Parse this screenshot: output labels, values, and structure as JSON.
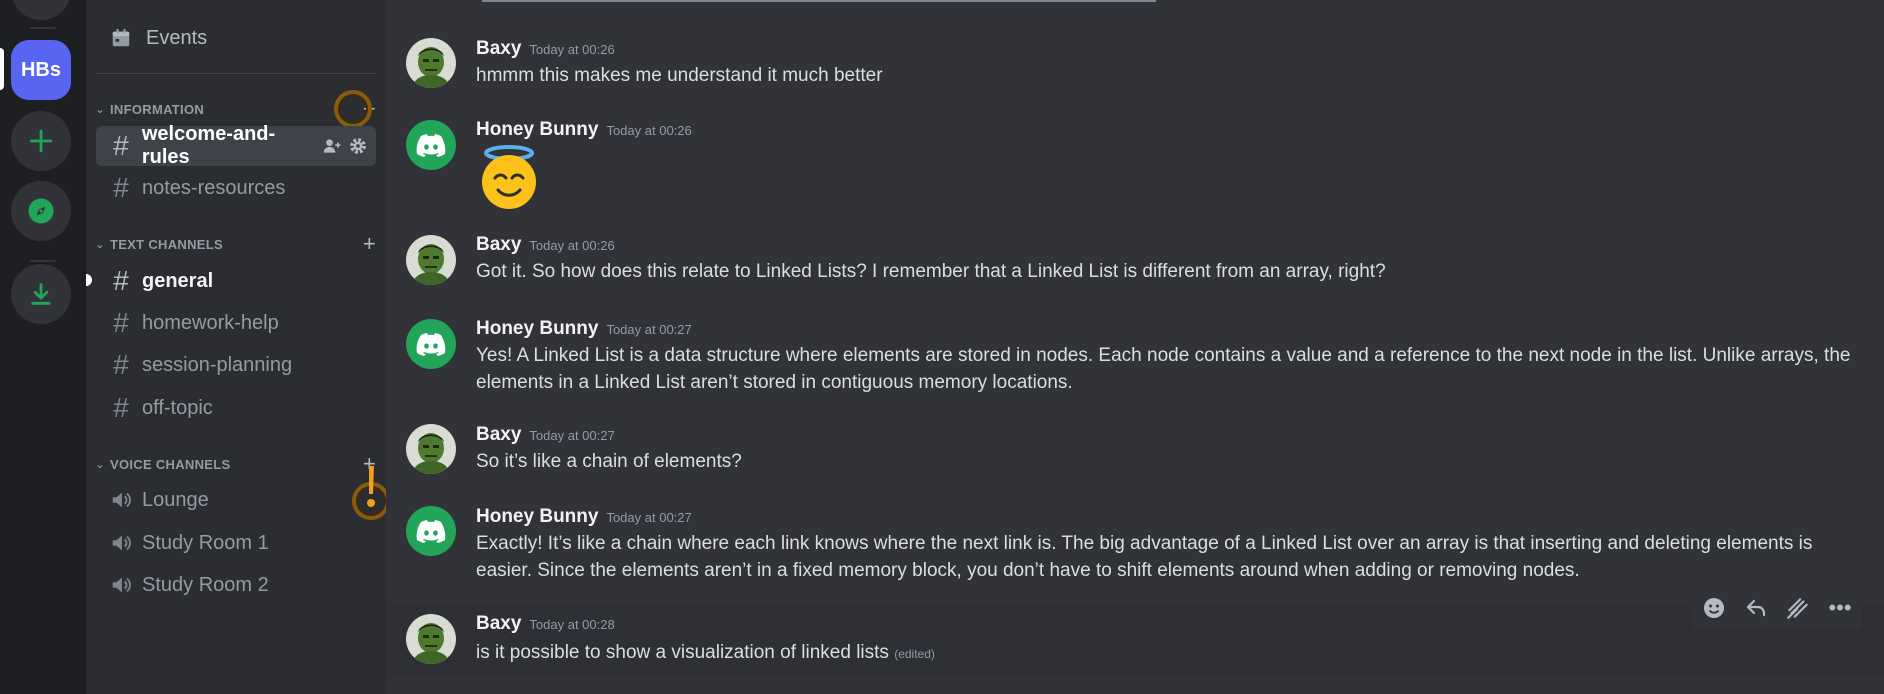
{
  "rail": {
    "server_initials": "HBs",
    "add_server_icon": "plus-icon",
    "discover_icon": "compass-icon",
    "download_icon": "download-icon",
    "accent_green": "#23a559",
    "accent_blurple": "#5865f2"
  },
  "sidebar": {
    "events_label": "Events",
    "categories": [
      {
        "label": "INFORMATION",
        "channels": [
          "welcome-and-rules",
          "notes-resources"
        ]
      },
      {
        "label": "TEXT CHANNELS",
        "channels": [
          "general",
          "homework-help",
          "session-planning",
          "off-topic"
        ]
      },
      {
        "label": "VOICE CHANNELS",
        "channels": [
          "Lounge",
          "Study Room 1",
          "Study Room 2"
        ]
      }
    ],
    "selected_channel": "welcome-and-rules",
    "unread_channel": "general"
  },
  "messages": [
    {
      "author": "Baxy",
      "time": "Today at 00:26",
      "text": "hmmm this makes me understand it much better"
    },
    {
      "author": "Honey Bunny",
      "time": "Today at 00:26",
      "text": "😇"
    },
    {
      "author": "Baxy",
      "time": "Today at 00:26",
      "text": "Got it. So how does this relate to Linked Lists? I remember that a Linked List is different from an array, right?"
    },
    {
      "author": "Honey Bunny",
      "time": "Today at 00:27",
      "text": "Yes! A Linked List is a data structure where elements are stored in nodes. Each node contains a value and a reference to the next node in the list. Unlike arrays, the elements in a Linked List aren’t stored in contiguous memory locations."
    },
    {
      "author": "Baxy",
      "time": "Today at 00:27",
      "text": "So it’s like a chain of elements?"
    },
    {
      "author": "Honey Bunny",
      "time": "Today at 00:27",
      "text": "Exactly! It’s like a chain where each link knows where the next link is. The big advantage of a Linked List over an array is that inserting and deleting elements is easier. Since the elements aren’t in a fixed memory block, you don’t have to shift elements around when adding or removing nodes."
    },
    {
      "author": "Baxy",
      "time": "Today at 00:28",
      "text": "is it possible to show a visualization of linked lists",
      "edited": "(edited)"
    }
  ],
  "toolbar": {
    "icons": [
      "emoji-icon",
      "reply-icon",
      "forward-icon",
      "more-icon"
    ],
    "more_glyph": "•••"
  }
}
